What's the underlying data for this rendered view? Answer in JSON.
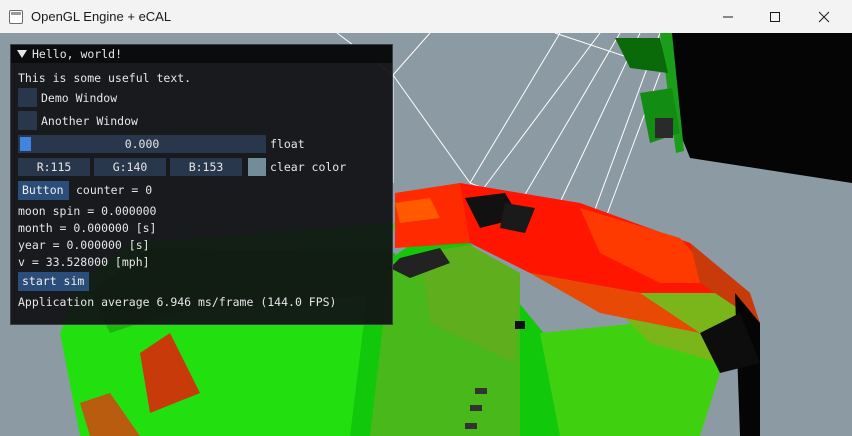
{
  "window": {
    "title": "OpenGL Engine + eCAL",
    "controls": {
      "minimize_icon": "minimize-icon",
      "maximize_icon": "maximize-icon",
      "close_icon": "close-icon"
    }
  },
  "scene": {
    "background_color": "#8c9aa4",
    "model_colors": [
      "#ff1a00",
      "#19ff00",
      "#000000"
    ]
  },
  "imgui": {
    "title": "Hello, world!",
    "text": "This is some useful text.",
    "checkboxes": [
      {
        "label": "Demo Window",
        "checked": false
      },
      {
        "label": "Another Window",
        "checked": false
      }
    ],
    "slider": {
      "value": "0.000",
      "label": "float",
      "fraction": 0.0
    },
    "clear_color": {
      "r": "R:115",
      "g": "G:140",
      "b": "B:153",
      "label": "clear color",
      "swatch": "#738c99"
    },
    "button_label": "Button",
    "counter_text": "counter = 0",
    "stats": [
      "moon spin = 0.000000",
      "month = 0.000000 [s]",
      "year = 0.000000 [s]",
      "v = 33.528000 [mph]"
    ],
    "start_button_label": "start sim",
    "fps_text": "Application average 6.946 ms/frame (144.0 FPS)"
  }
}
